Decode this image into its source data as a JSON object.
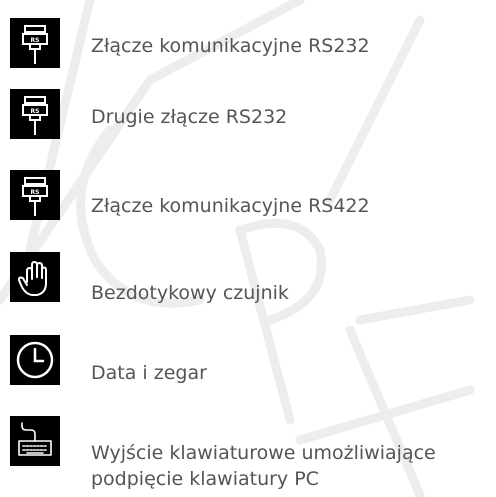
{
  "features": [
    {
      "icon": "rs232-connector-icon",
      "label": "Złącze komunikacyjne RS232",
      "badge": "RS"
    },
    {
      "icon": "rs232-connector-icon",
      "label": "Drugie złącze RS232",
      "badge": "RS"
    },
    {
      "icon": "rs422-connector-icon",
      "label": "Złącze komunikacyjne RS422",
      "badge": "RS"
    },
    {
      "icon": "hand-sensor-icon",
      "label": "Bezdotykowy czujnik"
    },
    {
      "icon": "clock-icon",
      "label": "Data i zegar"
    },
    {
      "icon": "keyboard-icon",
      "label": "Wyjście klawiaturowe umożliwiające",
      "label_line2": "podpięcie klawiatury PC"
    }
  ],
  "colors": {
    "icon_background": "#000000",
    "icon_foreground": "#ffffff",
    "text": "#555555",
    "watermark": "#ededed"
  }
}
